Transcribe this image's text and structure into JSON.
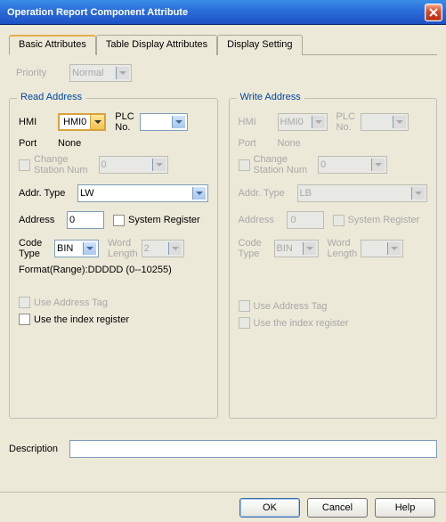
{
  "window": {
    "title": "Operation Report Component Attribute"
  },
  "tabs": [
    {
      "label": "Basic Attributes"
    },
    {
      "label": "Table Display Attributes"
    },
    {
      "label": "Display Setting"
    }
  ],
  "priority": {
    "label": "Priority",
    "value": "Normal"
  },
  "read": {
    "legend": "Read Address",
    "hmi_label": "HMI",
    "hmi_value": "HMI0",
    "plcno_label": "PLC\nNo.",
    "plcno_value": "",
    "port_label": "Port",
    "port_value": "None",
    "changestation_label": "Change\nStation Num",
    "changestation_value": "0",
    "addrtype_label": "Addr. Type",
    "addrtype_value": "LW",
    "address_label": "Address",
    "address_value": "0",
    "sysreg_label": "System Register",
    "codetype_label": "Code\nType",
    "codetype_value": "BIN",
    "wordlen_label": "Word\nLength",
    "wordlen_value": "2",
    "format_label": "Format(Range):DDDDD (0--10255)",
    "use_addrtag_label": "Use Address Tag",
    "use_indexreg_label": "Use the index register"
  },
  "write": {
    "legend": "Write Address",
    "hmi_label": "HMI",
    "hmi_value": "HMI0",
    "plcno_label": "PLC\nNo.",
    "plcno_value": "",
    "port_label": "Port",
    "port_value": "None",
    "changestation_label": "Change\nStation Num",
    "changestation_value": "0",
    "addrtype_label": "Addr. Type",
    "addrtype_value": "LB",
    "address_label": "Address",
    "address_value": "0",
    "sysreg_label": "System Register",
    "codetype_label": "Code\nType",
    "codetype_value": "BIN",
    "wordlen_label": "Word\nLength",
    "wordlen_value": "",
    "use_addrtag_label": "Use Address Tag",
    "use_indexreg_label": "Use the index register"
  },
  "description": {
    "label": "Description",
    "value": ""
  },
  "buttons": {
    "ok": "OK",
    "cancel": "Cancel",
    "help": "Help"
  }
}
